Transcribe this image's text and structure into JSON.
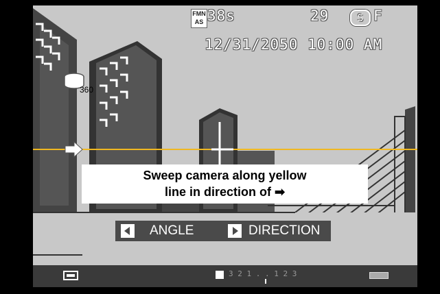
{
  "osd": {
    "film_badge_top": "FMN",
    "film_badge_bottom": "AS",
    "remaining_time": "38s",
    "frames_remaining": "29",
    "quality_icon": "S",
    "image_size": "F",
    "date": "12/31/2050",
    "time": "10:00 AM",
    "rotation_label": "360"
  },
  "instruction": {
    "line1": "Sweep camera along yellow",
    "line2": "line in direction of ➡"
  },
  "buttons": {
    "angle_label": "ANGLE",
    "direction_label": "DIRECTION"
  },
  "status": {
    "exposure_scale": "3 2 1 . . 1 2 3"
  },
  "colors": {
    "guide_line": "#f0b820",
    "sky": "#c8c8c8",
    "building": "#555555"
  },
  "icons": {
    "panorama_mode": "panorama-360-icon",
    "guide_arrow": "right-arrow-icon",
    "battery": "battery-icon",
    "exposure": "exposure-comp-icon",
    "panorama_frame": "panorama-frame-icon"
  }
}
